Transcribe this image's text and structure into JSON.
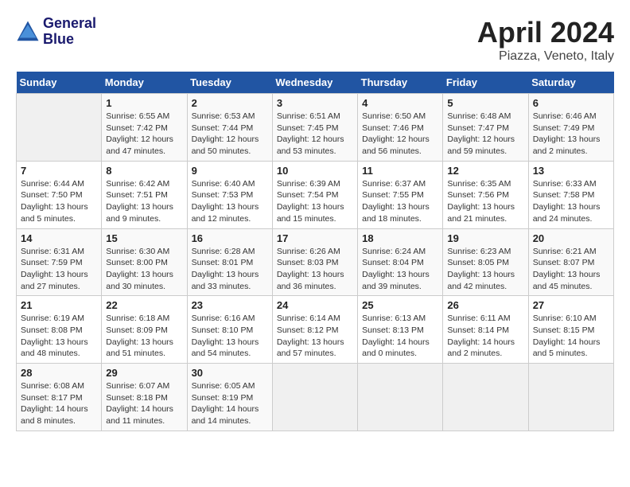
{
  "header": {
    "logo_line1": "General",
    "logo_line2": "Blue",
    "month": "April 2024",
    "location": "Piazza, Veneto, Italy"
  },
  "weekdays": [
    "Sunday",
    "Monday",
    "Tuesday",
    "Wednesday",
    "Thursday",
    "Friday",
    "Saturday"
  ],
  "weeks": [
    [
      {
        "day": "",
        "info": ""
      },
      {
        "day": "1",
        "info": "Sunrise: 6:55 AM\nSunset: 7:42 PM\nDaylight: 12 hours\nand 47 minutes."
      },
      {
        "day": "2",
        "info": "Sunrise: 6:53 AM\nSunset: 7:44 PM\nDaylight: 12 hours\nand 50 minutes."
      },
      {
        "day": "3",
        "info": "Sunrise: 6:51 AM\nSunset: 7:45 PM\nDaylight: 12 hours\nand 53 minutes."
      },
      {
        "day": "4",
        "info": "Sunrise: 6:50 AM\nSunset: 7:46 PM\nDaylight: 12 hours\nand 56 minutes."
      },
      {
        "day": "5",
        "info": "Sunrise: 6:48 AM\nSunset: 7:47 PM\nDaylight: 12 hours\nand 59 minutes."
      },
      {
        "day": "6",
        "info": "Sunrise: 6:46 AM\nSunset: 7:49 PM\nDaylight: 13 hours\nand 2 minutes."
      }
    ],
    [
      {
        "day": "7",
        "info": "Sunrise: 6:44 AM\nSunset: 7:50 PM\nDaylight: 13 hours\nand 5 minutes."
      },
      {
        "day": "8",
        "info": "Sunrise: 6:42 AM\nSunset: 7:51 PM\nDaylight: 13 hours\nand 9 minutes."
      },
      {
        "day": "9",
        "info": "Sunrise: 6:40 AM\nSunset: 7:53 PM\nDaylight: 13 hours\nand 12 minutes."
      },
      {
        "day": "10",
        "info": "Sunrise: 6:39 AM\nSunset: 7:54 PM\nDaylight: 13 hours\nand 15 minutes."
      },
      {
        "day": "11",
        "info": "Sunrise: 6:37 AM\nSunset: 7:55 PM\nDaylight: 13 hours\nand 18 minutes."
      },
      {
        "day": "12",
        "info": "Sunrise: 6:35 AM\nSunset: 7:56 PM\nDaylight: 13 hours\nand 21 minutes."
      },
      {
        "day": "13",
        "info": "Sunrise: 6:33 AM\nSunset: 7:58 PM\nDaylight: 13 hours\nand 24 minutes."
      }
    ],
    [
      {
        "day": "14",
        "info": "Sunrise: 6:31 AM\nSunset: 7:59 PM\nDaylight: 13 hours\nand 27 minutes."
      },
      {
        "day": "15",
        "info": "Sunrise: 6:30 AM\nSunset: 8:00 PM\nDaylight: 13 hours\nand 30 minutes."
      },
      {
        "day": "16",
        "info": "Sunrise: 6:28 AM\nSunset: 8:01 PM\nDaylight: 13 hours\nand 33 minutes."
      },
      {
        "day": "17",
        "info": "Sunrise: 6:26 AM\nSunset: 8:03 PM\nDaylight: 13 hours\nand 36 minutes."
      },
      {
        "day": "18",
        "info": "Sunrise: 6:24 AM\nSunset: 8:04 PM\nDaylight: 13 hours\nand 39 minutes."
      },
      {
        "day": "19",
        "info": "Sunrise: 6:23 AM\nSunset: 8:05 PM\nDaylight: 13 hours\nand 42 minutes."
      },
      {
        "day": "20",
        "info": "Sunrise: 6:21 AM\nSunset: 8:07 PM\nDaylight: 13 hours\nand 45 minutes."
      }
    ],
    [
      {
        "day": "21",
        "info": "Sunrise: 6:19 AM\nSunset: 8:08 PM\nDaylight: 13 hours\nand 48 minutes."
      },
      {
        "day": "22",
        "info": "Sunrise: 6:18 AM\nSunset: 8:09 PM\nDaylight: 13 hours\nand 51 minutes."
      },
      {
        "day": "23",
        "info": "Sunrise: 6:16 AM\nSunset: 8:10 PM\nDaylight: 13 hours\nand 54 minutes."
      },
      {
        "day": "24",
        "info": "Sunrise: 6:14 AM\nSunset: 8:12 PM\nDaylight: 13 hours\nand 57 minutes."
      },
      {
        "day": "25",
        "info": "Sunrise: 6:13 AM\nSunset: 8:13 PM\nDaylight: 14 hours\nand 0 minutes."
      },
      {
        "day": "26",
        "info": "Sunrise: 6:11 AM\nSunset: 8:14 PM\nDaylight: 14 hours\nand 2 minutes."
      },
      {
        "day": "27",
        "info": "Sunrise: 6:10 AM\nSunset: 8:15 PM\nDaylight: 14 hours\nand 5 minutes."
      }
    ],
    [
      {
        "day": "28",
        "info": "Sunrise: 6:08 AM\nSunset: 8:17 PM\nDaylight: 14 hours\nand 8 minutes."
      },
      {
        "day": "29",
        "info": "Sunrise: 6:07 AM\nSunset: 8:18 PM\nDaylight: 14 hours\nand 11 minutes."
      },
      {
        "day": "30",
        "info": "Sunrise: 6:05 AM\nSunset: 8:19 PM\nDaylight: 14 hours\nand 14 minutes."
      },
      {
        "day": "",
        "info": ""
      },
      {
        "day": "",
        "info": ""
      },
      {
        "day": "",
        "info": ""
      },
      {
        "day": "",
        "info": ""
      }
    ]
  ]
}
